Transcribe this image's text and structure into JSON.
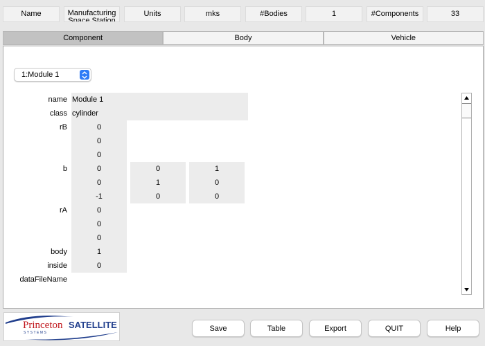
{
  "header": {
    "name_label": "Name",
    "name_value": "Manufacturing Space Station",
    "units_label": "Units",
    "units_value": "mks",
    "bodies_label": "#Bodies",
    "bodies_value": "1",
    "components_label": "#Components",
    "components_value": "33"
  },
  "tabs": [
    {
      "label": "Component",
      "active": true
    },
    {
      "label": "Body",
      "active": false
    },
    {
      "label": "Vehicle",
      "active": false
    }
  ],
  "component_select": {
    "value": "1:Module 1"
  },
  "fields": {
    "name_label": "name",
    "name_value": "Module 1",
    "class_label": "class",
    "class_value": "cylinder",
    "rB_label": "rB",
    "rB_values": [
      "0",
      "0",
      "0"
    ],
    "b_label": "b",
    "b_matrix": [
      [
        "0",
        "0",
        "1"
      ],
      [
        "0",
        "1",
        "0"
      ],
      [
        "-1",
        "0",
        "0"
      ]
    ],
    "rA_label": "rA",
    "rA_values": [
      "0",
      "0",
      "0"
    ],
    "body_label": "body",
    "body_value": "1",
    "inside_label": "inside",
    "inside_value": "0",
    "dataFileName_label": "dataFileName"
  },
  "logo": {
    "text_princeton": "Princeton",
    "text_satellite": "SATELLITE",
    "text_systems": "SYSTEMS",
    "color_red": "#c0161c",
    "color_blue": "#1f3d8c"
  },
  "buttons": {
    "save": "Save",
    "table": "Table",
    "export": "Export",
    "quit": "QUIT",
    "help": "Help"
  },
  "colors": {
    "accent": "#2f7cf6",
    "active_tab": "#c2c2c2"
  }
}
